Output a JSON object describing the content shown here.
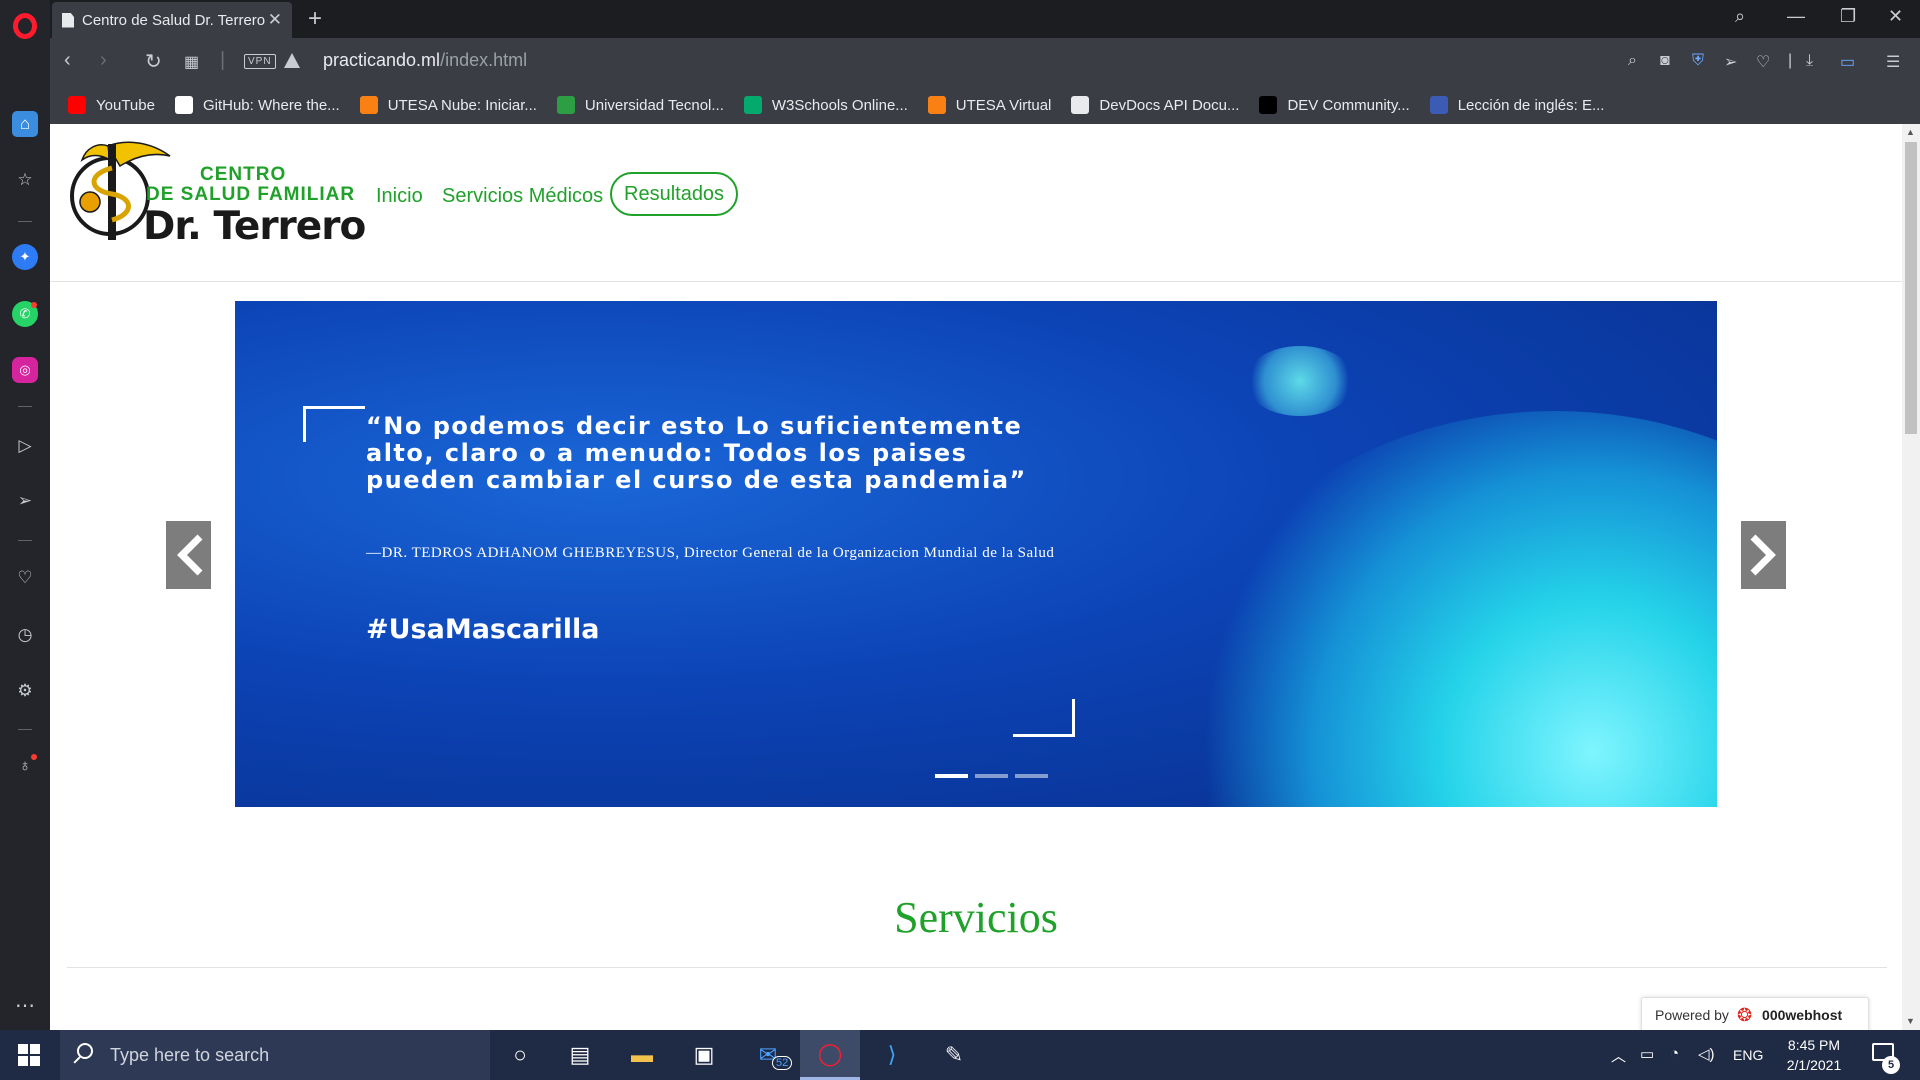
{
  "browser": {
    "tab_title": "Centro de Salud Dr. Terrero",
    "url_host": "practicando.ml",
    "url_path": "/index.html",
    "vpn_label": "VPN",
    "bookmarks": [
      {
        "label": "YouTube",
        "icon": "youtube-icon",
        "color": "#ff0000"
      },
      {
        "label": "GitHub: Where the...",
        "icon": "github-icon",
        "color": "#ffffff"
      },
      {
        "label": "UTESA Nube: Iniciar...",
        "icon": "moodle-icon",
        "color": "#f98012"
      },
      {
        "label": "Universidad Tecnol...",
        "icon": "utesa-icon",
        "color": "#2e9e44"
      },
      {
        "label": "W3Schools Online...",
        "icon": "w3schools-icon",
        "color": "#04aa6d"
      },
      {
        "label": "UTESA Virtual",
        "icon": "moodle-icon",
        "color": "#f98012"
      },
      {
        "label": "DevDocs API Docu...",
        "icon": "devdocs-icon",
        "color": "#e8eaed"
      },
      {
        "label": "DEV Community...",
        "icon": "dev-icon",
        "color": "#000000"
      },
      {
        "label": "Lección de inglés: E...",
        "icon": "flag-icon",
        "color": "#3c5bb5"
      }
    ]
  },
  "site": {
    "logo": {
      "line1": "CENTRO",
      "line2": "DE SALUD FAMILIAR",
      "line3": "Dr. Terrero"
    },
    "nav": {
      "inicio": "Inicio",
      "servicios": "Servicios Médicos",
      "resultados": "Resultados"
    },
    "slide": {
      "quote": "“No podemos decir esto Lo suficientemente alto, claro o a menudo: Todos los paises pueden cambiar el curso de esta pandemia”",
      "attribution": "—DR. TEDROS ADHANOM GHEBREYESUS, Director General de la Organizacion Mundial de la Salud",
      "hashtag": "#UsaMascarilla",
      "slide_count": 3,
      "active_slide": 1
    },
    "section_title": "Servicios",
    "powered_by": "Powered by",
    "powered_brand": "000webhost"
  },
  "taskbar": {
    "search_placeholder": "Type here to search",
    "mail_badge": "52",
    "language": "ENG",
    "time": "8:45 PM",
    "date": "2/1/2021",
    "notifications": "5"
  },
  "colors": {
    "brand_green": "#20a12a",
    "carousel_blue": "#0c43b5",
    "opera_red": "#ff1b2d"
  }
}
